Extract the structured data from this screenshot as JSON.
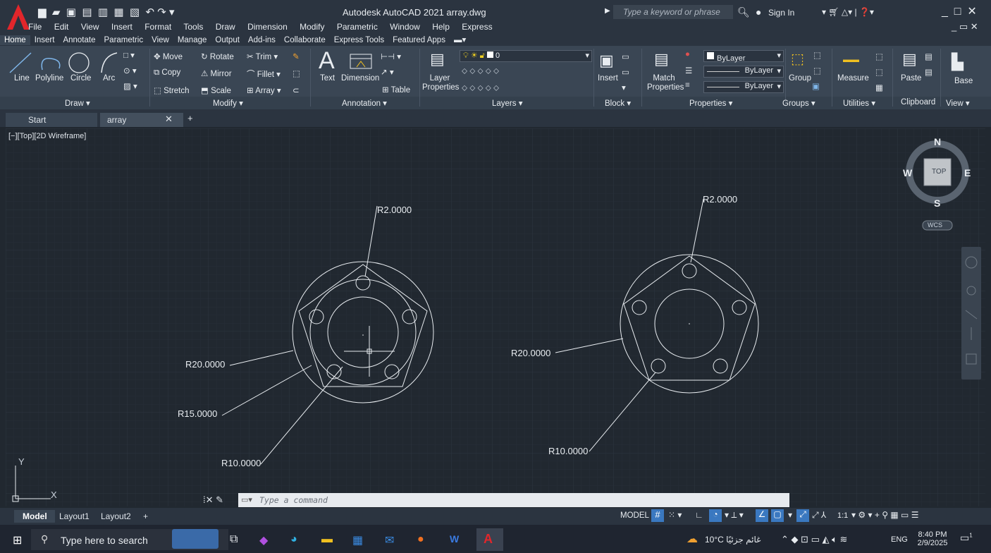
{
  "titlebar": {
    "title": "Autodesk AutoCAD 2021  array.dwg",
    "search_placeholder": "Type a keyword or phrase",
    "sign_in": "Sign In"
  },
  "menubar": [
    "File",
    "Edit",
    "View",
    "Insert",
    "Format",
    "Tools",
    "Draw",
    "Dimension",
    "Modify",
    "Parametric",
    "Window",
    "Help",
    "Express"
  ],
  "ribbon_tabs": [
    "Home",
    "Insert",
    "Annotate",
    "Parametric",
    "View",
    "Manage",
    "Output",
    "Add-ins",
    "Collaborate",
    "Express Tools",
    "Featured Apps"
  ],
  "ribbon": {
    "draw": {
      "line": "Line",
      "polyline": "Polyline",
      "circle": "Circle",
      "arc": "Arc",
      "label": "Draw ▾"
    },
    "modify": {
      "move": "Move",
      "rotate": "Rotate",
      "trim": "Trim",
      "copy": "Copy",
      "mirror": "Mirror",
      "fillet": "Fillet",
      "stretch": "Stretch",
      "scale": "Scale",
      "array": "Array",
      "label": "Modify ▾"
    },
    "annotation": {
      "text": "Text",
      "dimension": "Dimension",
      "table": "Table",
      "label": "Annotation ▾"
    },
    "layers": {
      "properties": "Layer Properties",
      "layer_value": "0",
      "label": "Layers ▾"
    },
    "block": {
      "insert": "Insert",
      "label": "Block ▾"
    },
    "properties": {
      "match": "Match Properties",
      "color": "ByLayer",
      "linetype": "ByLayer",
      "lineweight": "ByLayer",
      "label": "Properties ▾"
    },
    "groups": {
      "group": "Group",
      "label": "Groups ▾"
    },
    "utilities": {
      "measure": "Measure",
      "label": "Utilities ▾"
    },
    "clipboard": {
      "paste": "Paste",
      "label": "Clipboard"
    },
    "view": {
      "base": "Base",
      "label": "View ▾"
    }
  },
  "filetabs": {
    "start": "Start",
    "array": "array"
  },
  "viewport_label": "[−][Top][2D Wireframe]",
  "viewcube": {
    "n": "N",
    "s": "S",
    "e": "E",
    "w": "W",
    "top": "TOP",
    "wcs": "WCS"
  },
  "dimensions": {
    "left_r2": "R2.0000",
    "left_r20": "R20.0000",
    "left_r15": "R15.0000",
    "left_r10": "R10.0000",
    "right_r2": "R2.0000",
    "right_r20": "R20.0000",
    "right_r10": "R10.0000"
  },
  "ucs": {
    "x": "X",
    "y": "Y"
  },
  "command": {
    "placeholder": "Type a command"
  },
  "layout_tabs": [
    "Model",
    "Layout1",
    "Layout2"
  ],
  "status": {
    "model": "MODEL",
    "scale": "1:1"
  },
  "taskbar": {
    "search": "Type here to search",
    "weather": "10°C  غائم جزئيًا",
    "lang": "ENG",
    "time": "8:40 PM",
    "date": "2/9/2025",
    "notif": "1"
  }
}
